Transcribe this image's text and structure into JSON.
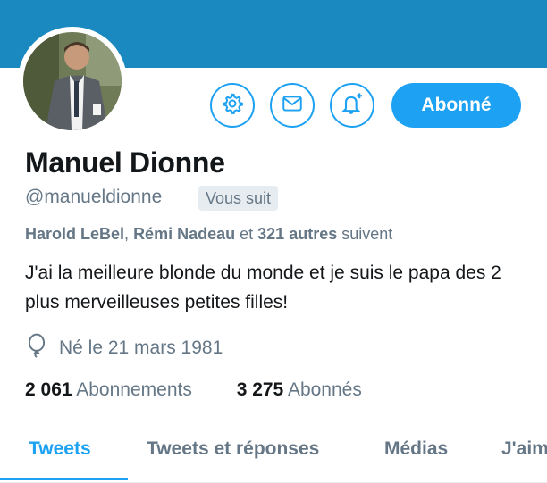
{
  "profile": {
    "name": "Manuel Dionne",
    "handle": "@manueldionne",
    "follows_you": "Vous suit",
    "known_followers": {
      "user1": "Harold LeBel",
      "separator": ",",
      "user2": "Rémi Nadeau",
      "and": "et",
      "count": "321 autres",
      "suffix": "suivent"
    },
    "bio": "J'ai la meilleure blonde du monde et je suis le papa des 2 plus merveilleuses petites filles!",
    "birth": "Né le 21 mars 1981"
  },
  "actions": {
    "follow_label": "Abonné",
    "settings_icon": "gear-icon",
    "message_icon": "envelope-icon",
    "notify_icon": "bell-plus-icon"
  },
  "stats": {
    "following_count": "2 061",
    "following_label": "Abonnements",
    "followers_count": "3 275",
    "followers_label": "Abonnés"
  },
  "tabs": [
    {
      "label": "Tweets",
      "active": true
    },
    {
      "label": "Tweets et réponses",
      "active": false
    },
    {
      "label": "Médias",
      "active": false
    },
    {
      "label": "J'aime",
      "active": false
    }
  ],
  "colors": {
    "banner": "#1a89c0",
    "accent": "#1da1f2",
    "secondary_text": "#657786",
    "primary_text": "#14171a"
  }
}
